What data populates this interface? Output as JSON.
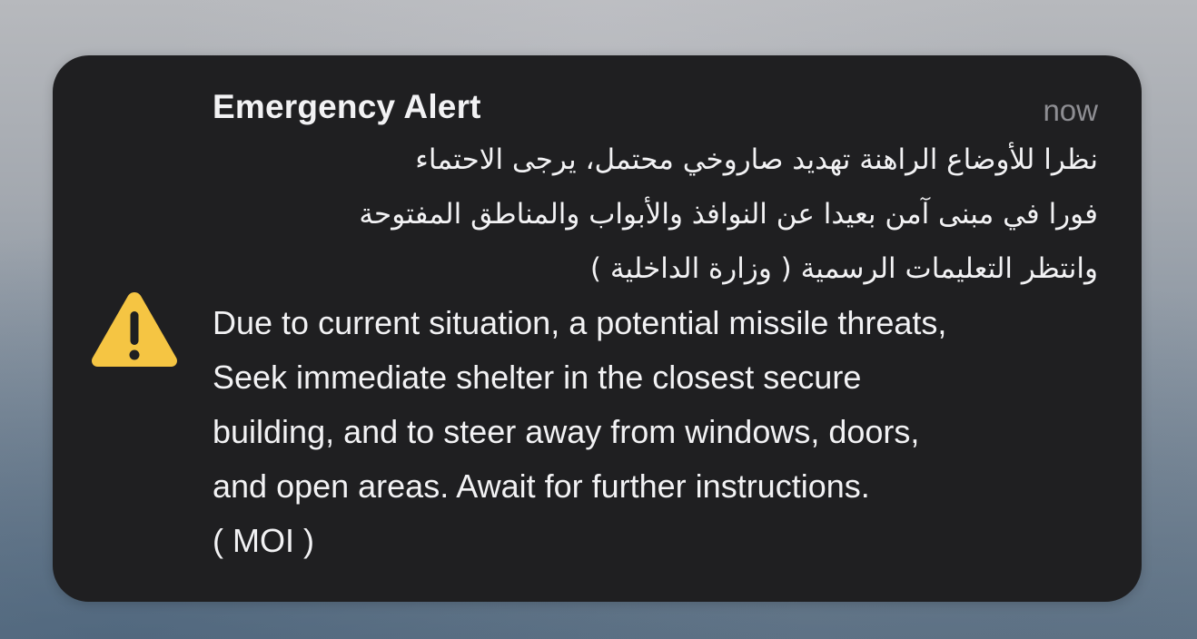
{
  "notification": {
    "title": "Emergency Alert",
    "timestamp": "now",
    "icon": "warning-triangle-icon",
    "icon_color": "#f5c543",
    "arabic_lines": [
      "نظرا للأوضاع الراهنة تهديد صاروخي محتمل، يرجى الاحتماء",
      "فورا في مبنى آمن بعيدا عن النوافذ والأبواب والمناطق المفتوحة",
      "وانتظر التعليمات الرسمية ( وزارة الداخلية )"
    ],
    "english_lines": [
      "Due to current situation, a potential missile threats,",
      "Seek immediate shelter in the closest secure",
      "building, and to steer away from windows, doors,",
      "and open areas. Await for further instructions.",
      "( MOI  )"
    ]
  }
}
